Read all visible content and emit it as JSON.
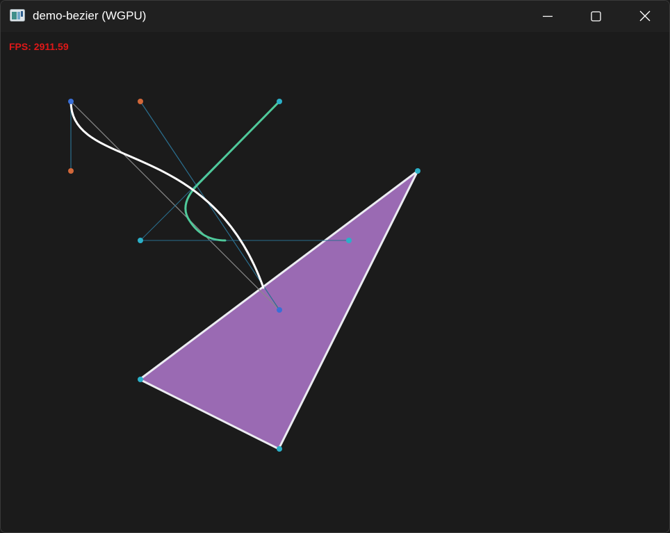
{
  "window": {
    "title": "demo-bezier (WGPU)",
    "icon": "app-window-icon"
  },
  "controls": {
    "minimize_icon": "minimize-icon",
    "maximize_icon": "maximize-icon",
    "close_icon": "close-icon"
  },
  "overlay": {
    "fps_text": "FPS: 2911.59",
    "fps_color": "#e01818"
  },
  "colors": {
    "background": "#1b1b1b",
    "titlebar": "#202020",
    "triangle_fill": "#9a6ab3",
    "outline_white": "#ffffff",
    "teal_curve": "#4fc99a",
    "handle_cyan": "#2bb0c8",
    "handle_orange": "#d2683a",
    "handle_blue": "#3a6fd6",
    "guide_blue": "#2a6f8f",
    "guide_gray": "#8a8a8a"
  }
}
